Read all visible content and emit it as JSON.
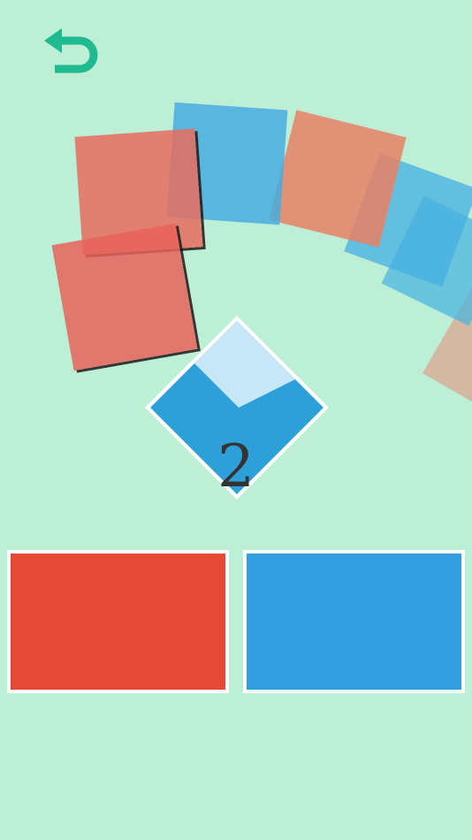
{
  "header": {
    "undo_icon": "undo-arrow-icon"
  },
  "colors": {
    "background": "#bdeed6",
    "accent": "#1fba8f",
    "red": "#e64a37",
    "blue": "#339fe0",
    "red_tile": "#e8786a",
    "blue_tile": "#54b3d8"
  },
  "game": {
    "score": "2"
  },
  "choices": [
    {
      "color_name": "red",
      "color": "#e64a37"
    },
    {
      "color_name": "blue",
      "color": "#339fe0"
    }
  ]
}
